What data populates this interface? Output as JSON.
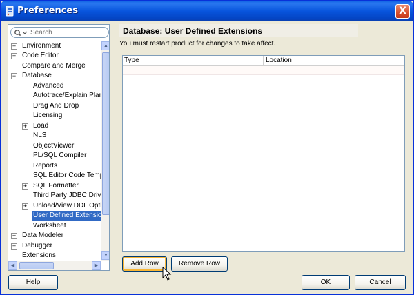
{
  "window": {
    "title": "Preferences",
    "close_label": "X"
  },
  "search": {
    "placeholder": "Search"
  },
  "tree": {
    "items": [
      {
        "label": "Environment",
        "expander": "+"
      },
      {
        "label": "Code Editor",
        "expander": "+"
      },
      {
        "label": "Compare and Merge",
        "expander": ""
      },
      {
        "label": "Database",
        "expander": "−"
      },
      {
        "label": "Advanced",
        "expander": ""
      },
      {
        "label": "Autotrace/Explain Plan",
        "expander": ""
      },
      {
        "label": "Drag And Drop",
        "expander": ""
      },
      {
        "label": "Licensing",
        "expander": ""
      },
      {
        "label": "Load",
        "expander": "+"
      },
      {
        "label": "NLS",
        "expander": ""
      },
      {
        "label": "ObjectViewer",
        "expander": ""
      },
      {
        "label": "PL/SQL Compiler",
        "expander": ""
      },
      {
        "label": "Reports",
        "expander": ""
      },
      {
        "label": "SQL Editor Code Templa",
        "expander": ""
      },
      {
        "label": "SQL Formatter",
        "expander": "+"
      },
      {
        "label": "Third Party JDBC Driver",
        "expander": ""
      },
      {
        "label": "Unload/View DDL Optio",
        "expander": "+"
      },
      {
        "label": "User Defined Extension",
        "expander": ""
      },
      {
        "label": "Worksheet",
        "expander": ""
      },
      {
        "label": "Data Modeler",
        "expander": "+"
      },
      {
        "label": "Debugger",
        "expander": "+"
      },
      {
        "label": "Extensions",
        "expander": ""
      }
    ]
  },
  "main": {
    "title": "Database: User Defined Extensions",
    "info": "You must restart product for changes to take affect.",
    "table": {
      "columns": [
        "Type",
        "Location"
      ]
    },
    "add_row_label": "Add Row",
    "remove_row_label": "Remove Row"
  },
  "footer": {
    "help_label": "Help",
    "ok_label": "OK",
    "cancel_label": "Cancel"
  },
  "colors": {
    "titlebar": "#0855dd",
    "selection": "#316ac5",
    "dialog_bg": "#ece9d8"
  }
}
